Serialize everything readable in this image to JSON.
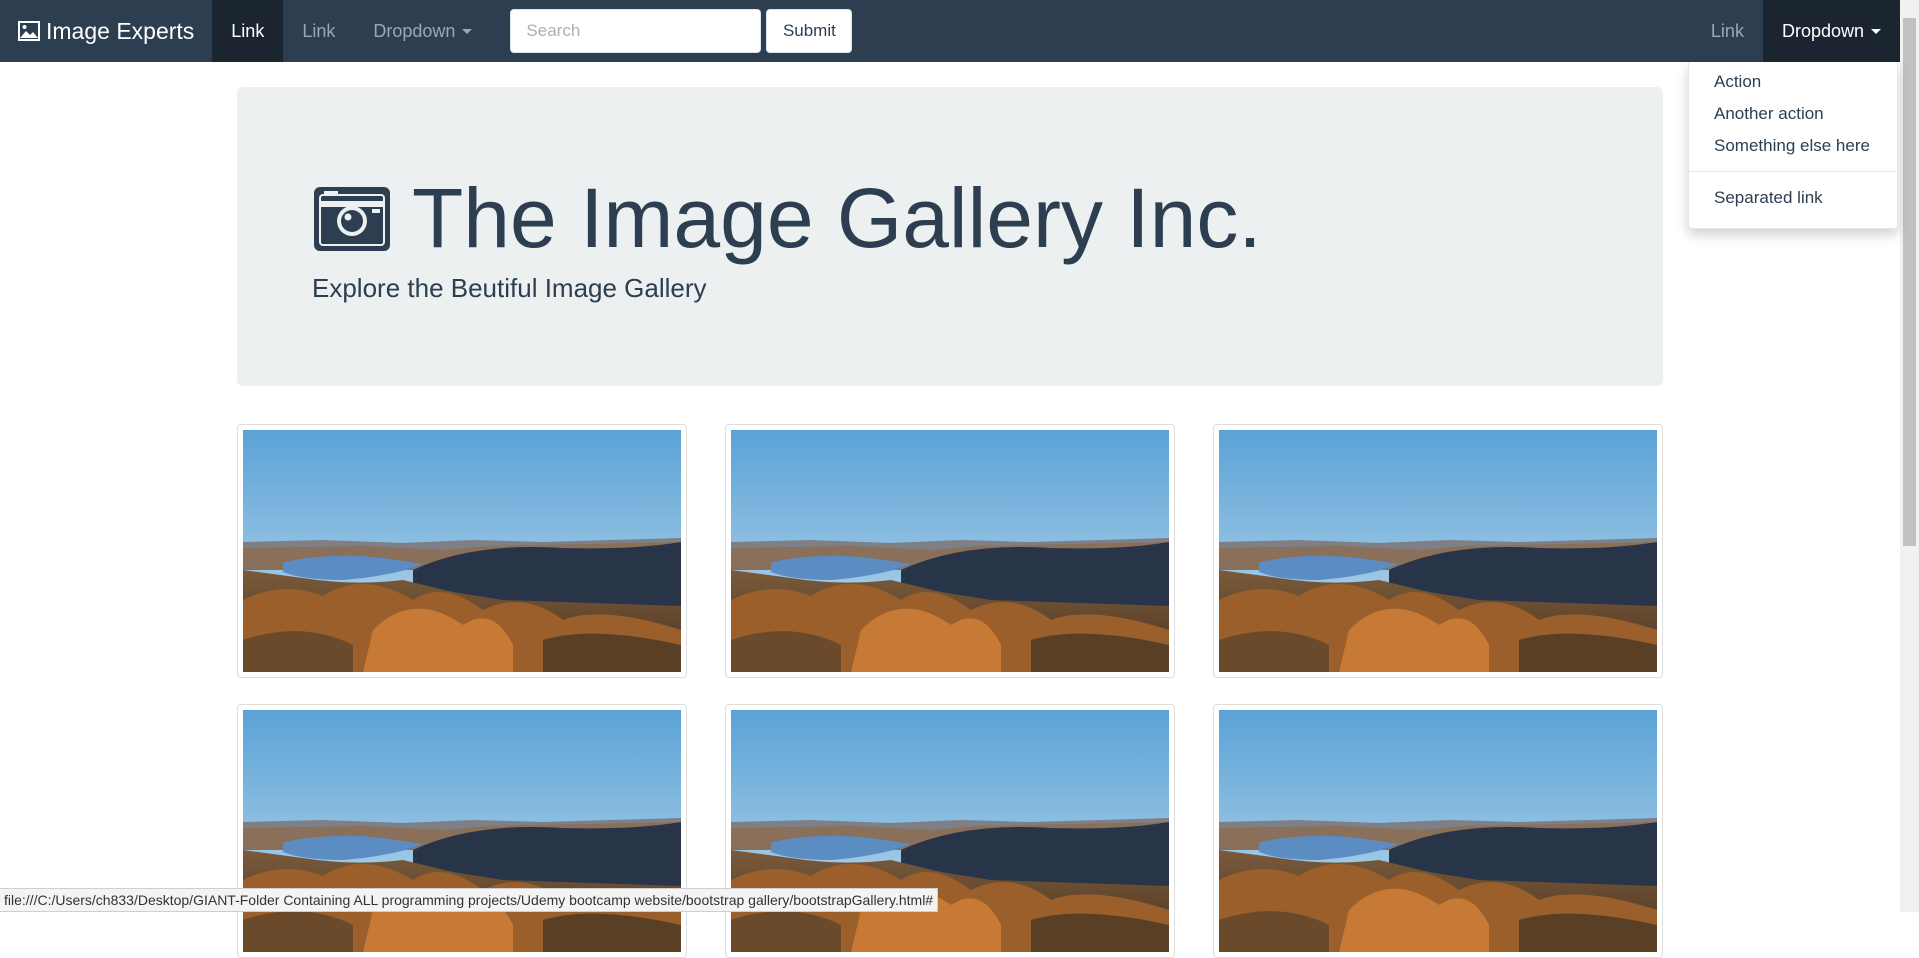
{
  "navbar": {
    "brand": "Image Experts",
    "brand_icon": "picture-icon",
    "left_items": [
      {
        "label": "Link",
        "active": true
      },
      {
        "label": "Link",
        "active": false
      },
      {
        "label": "Dropdown",
        "active": false
      }
    ],
    "search": {
      "placeholder": "Search",
      "value": ""
    },
    "submit_label": "Submit",
    "right_items": [
      {
        "label": "Link",
        "active": false
      },
      {
        "label": "Dropdown",
        "active": true
      }
    ]
  },
  "dropdown_menu": {
    "items": [
      "Action",
      "Another action",
      "Something else here"
    ],
    "separated_item": "Separated link"
  },
  "jumbotron": {
    "icon": "camera-icon",
    "title": "The Image Gallery Inc.",
    "subtitle": "Explore the Beutiful Image Gallery"
  },
  "gallery": {
    "thumbnail_count": 6,
    "image_description_icon": "landscape-photo"
  },
  "status_bar": {
    "url": "file:///C:/Users/ch833/Desktop/GIANT-Folder Containing ALL programming projects/Udemy bootcamp website/bootstrap gallery/bootstrapGallery.html#"
  },
  "colors": {
    "navbar": "#2c3e50",
    "navbar_active": "#1a252f",
    "jumbotron": "#ecf0f1",
    "text": "#2c3e50"
  }
}
